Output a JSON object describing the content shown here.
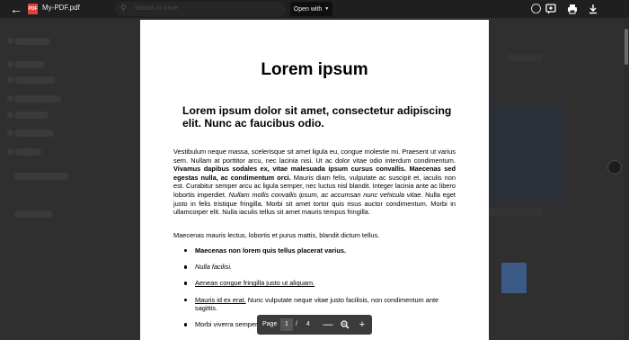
{
  "topbar": {
    "file_name": "My-PDF.pdf",
    "file_type_label": "PDF",
    "search_placeholder": "Search in Drive",
    "open_with_label": "Open with",
    "icons": [
      "arrow-back-icon",
      "pdf-file-icon",
      "add-comment-icon",
      "print-icon",
      "download-icon"
    ]
  },
  "document": {
    "title": "Lorem ipsum",
    "heading": "Lorem ipsum dolor sit amet, consectetur adipiscing elit. Nunc ac faucibus odio.",
    "p1_a": "Vestibulum neque massa, scelerisque sit amet ligula eu, congue molestie mi. Praesent ut varius sem. Nullam at porttitor arcu, nec lacinia nisi. Ut ac dolor vitae odio interdum condimentum. ",
    "p1_b": "Vivamus dapibus sodales ex, vitae malesuada ipsum cursus convallis. Maecenas sed egestas nulla, ac condimentum orci.",
    "p1_c": " Mauris diam felis, vulputate ac suscipit et, iaculis non est. Curabitur semper arcu ac ligula semper, nec luctus nisl blandit. Integer lacinia ante ac libero lobortis imperdiet. ",
    "p1_d": "Nullam mollis convallis ipsum, ac accumsan nunc vehicula vitae.",
    "p1_e": " Nulla eget justo in felis tristique fringilla. Morbi sit amet tortor quis risus auctor condimentum. Morbi in ullamcorper elit. Nulla iaculis tellus sit amet mauris tempus fringilla.",
    "p2": "Maecenas mauris lectus, lobortis et purus mattis, blandit dictum tellus.",
    "list": {
      "item1": "Maecenas non lorem quis tellus placerat varius.",
      "item2": "Nulla facilisi.",
      "item3": "Aenean congue fringilla justo ut aliquam.",
      "item4_link": "Mauris id ex erat.",
      "item4_rest": " Nunc vulputate neque vitae justo facilisis, non condimentum ante sagittis.",
      "item5": "Morbi viverra semper"
    }
  },
  "pager": {
    "label": "Page",
    "current": "1",
    "separator": "/",
    "total": "4",
    "icons": [
      "zoom-out-icon",
      "zoom-reset-icon",
      "zoom-in-icon"
    ]
  }
}
